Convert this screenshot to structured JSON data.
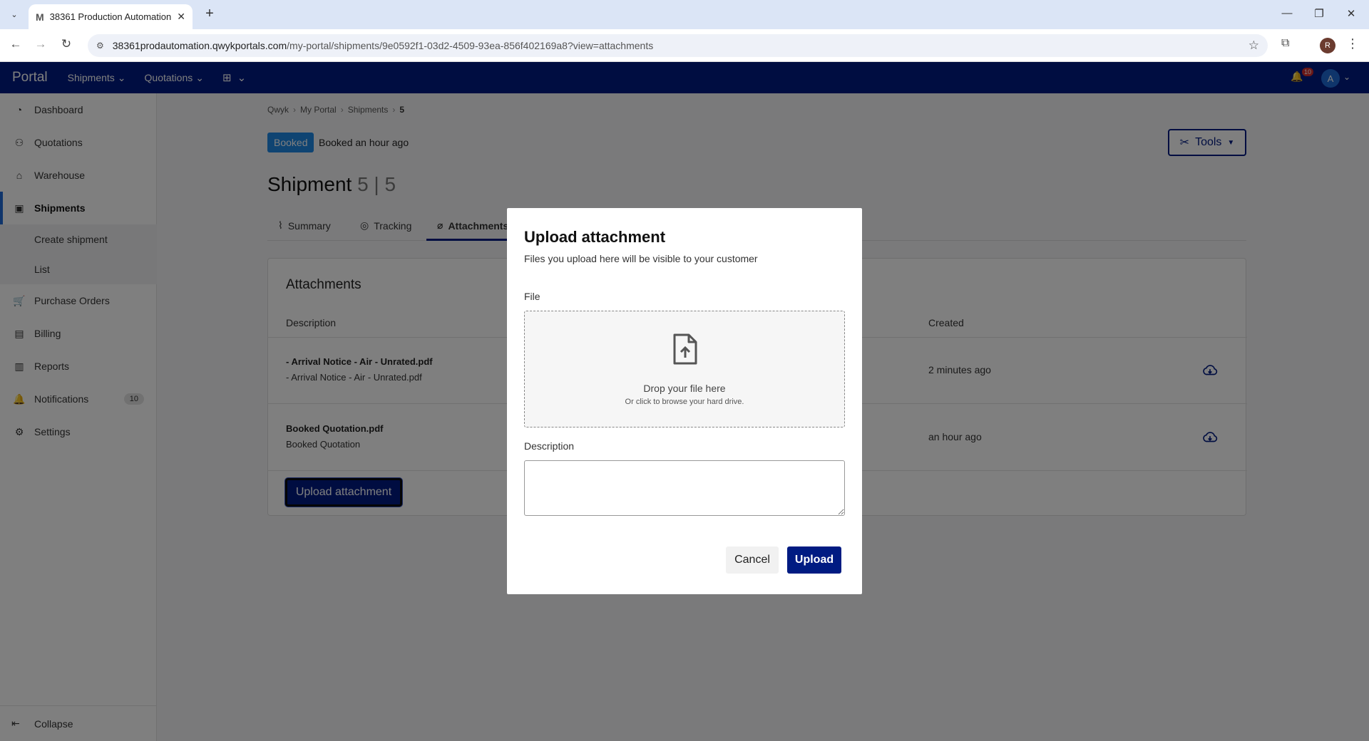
{
  "browser": {
    "tab_title": "38361 Production Automation",
    "url_host": "38361prodautomation.qwykportals.com",
    "url_path": "/my-portal/shipments/9e0592f1-03d2-4509-93ea-856f402169a8?view=attachments",
    "profile_initial": "R"
  },
  "topnav": {
    "brand": "Portal",
    "menus": [
      "Shipments",
      "Quotations"
    ],
    "notification_count": "10",
    "avatar_initial": "A"
  },
  "sidebar": {
    "items": [
      {
        "label": "Dashboard",
        "icon": "dashboard-icon"
      },
      {
        "label": "Quotations",
        "icon": "quotations-icon"
      },
      {
        "label": "Warehouse",
        "icon": "warehouse-icon"
      },
      {
        "label": "Shipments",
        "icon": "shipments-icon"
      },
      {
        "label": "Purchase Orders",
        "icon": "cart-icon"
      },
      {
        "label": "Billing",
        "icon": "billing-icon"
      },
      {
        "label": "Reports",
        "icon": "reports-icon"
      },
      {
        "label": "Notifications",
        "icon": "bell-icon",
        "badge": "10"
      },
      {
        "label": "Settings",
        "icon": "gear-icon"
      }
    ],
    "sub_items": [
      "Create shipment",
      "List"
    ],
    "collapse_label": "Collapse"
  },
  "breadcrumb": [
    "Qwyk",
    "My Portal",
    "Shipments",
    "5"
  ],
  "status": {
    "badge": "Booked",
    "text": "Booked an hour ago"
  },
  "tools_label": "Tools",
  "title": {
    "prefix": "Shipment",
    "number": "5 | 5"
  },
  "tabs": [
    "Summary",
    "Tracking",
    "Attachments"
  ],
  "attachments": {
    "heading": "Attachments",
    "columns": {
      "description": "Description",
      "created": "Created"
    },
    "rows": [
      {
        "name": "- Arrival Notice - Air - Unrated.pdf",
        "description": "- Arrival Notice - Air - Unrated.pdf",
        "created": "2 minutes ago"
      },
      {
        "name": "Booked Quotation.pdf",
        "description": "Booked Quotation",
        "created": "an hour ago"
      }
    ],
    "upload_button": "Upload attachment"
  },
  "modal": {
    "title": "Upload attachment",
    "subtitle": "Files you upload here will be visible to your customer",
    "file_label": "File",
    "drop_text": "Drop your file here",
    "drop_hint": "Or click to browse your hard drive.",
    "description_label": "Description",
    "description_value": "",
    "cancel": "Cancel",
    "upload": "Upload"
  },
  "colors": {
    "brand_navy": "#001b82",
    "badge_blue": "#1e88e5",
    "accent_blue": "#1e6ad6"
  }
}
